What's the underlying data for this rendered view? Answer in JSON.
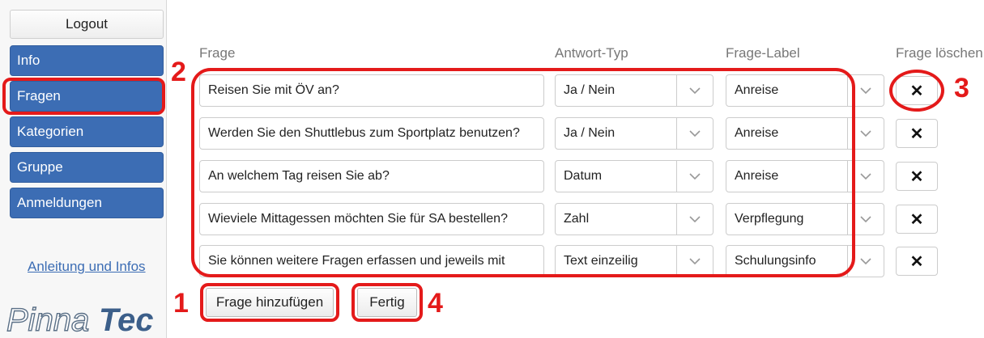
{
  "sidebar": {
    "logout_label": "Logout",
    "items": [
      {
        "label": "Info"
      },
      {
        "label": "Fragen"
      },
      {
        "label": "Kategorien"
      },
      {
        "label": "Gruppe"
      },
      {
        "label": "Anmeldungen"
      }
    ],
    "guide_link": "Anleitung und Infos",
    "logo_text_1": "Pinna",
    "logo_text_2": "Tec"
  },
  "table": {
    "headers": {
      "question": "Frage",
      "answer_type": "Antwort-Typ",
      "question_label": "Frage-Label",
      "delete": "Frage löschen"
    },
    "rows": [
      {
        "question": "Reisen Sie mit ÖV an?",
        "answer_type": "Ja / Nein",
        "label": "Anreise"
      },
      {
        "question": "Werden Sie den Shuttlebus zum Sportplatz benutzen?",
        "answer_type": "Ja / Nein",
        "label": "Anreise"
      },
      {
        "question": "An welchem Tag reisen Sie ab?",
        "answer_type": "Datum",
        "label": "Anreise"
      },
      {
        "question": "Wieviele Mittagessen möchten Sie für SA bestellen?",
        "answer_type": "Zahl",
        "label": "Verpflegung"
      },
      {
        "question": "Sie können weitere Fragen erfassen und jeweils mit",
        "answer_type": "Text einzeilig",
        "label": "Schulungsinfo"
      }
    ],
    "delete_symbol": "✕"
  },
  "actions": {
    "add_question_label": "Frage hinzufügen",
    "done_label": "Fertig"
  },
  "annotations": {
    "n1": "1",
    "n2": "2",
    "n3": "3",
    "n4": "4",
    "color": "#e41a1a"
  },
  "colors": {
    "nav_blue": "#3c6db4",
    "accent_red": "#e41a1a"
  }
}
